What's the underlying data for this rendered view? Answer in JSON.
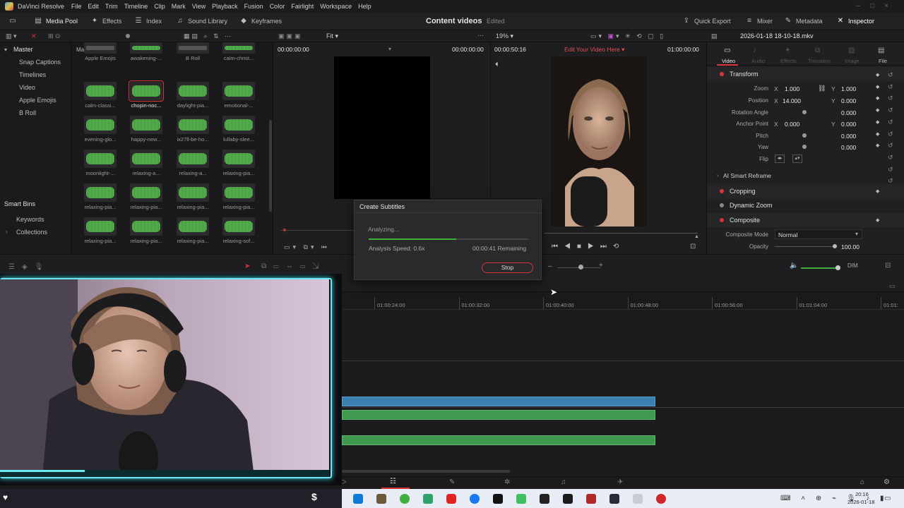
{
  "app": {
    "name": "DaVinci Resolve",
    "menus": [
      "File",
      "Edit",
      "Trim",
      "Timeline",
      "Clip",
      "Mark",
      "View",
      "Playback",
      "Fusion",
      "Color",
      "Fairlight",
      "Workspace",
      "Help"
    ]
  },
  "toolbar": {
    "media_pool": "Media Pool",
    "effects": "Effects",
    "index": "Index",
    "sound_library": "Sound Library",
    "keyframes": "Keyframes",
    "project_title": "Content videos",
    "project_status": "Edited",
    "quick_export": "Quick Export",
    "mixer": "Mixer",
    "metadata": "Metadata",
    "inspector": "Inspector"
  },
  "strip2": {
    "fit": "Fit",
    "zoom": "19%",
    "filename": "2026-01-18 18-10-18.mkv"
  },
  "bins": {
    "master": "Master",
    "items": [
      "Snap Captions",
      "Timelines",
      "Video",
      "Apple Emojis",
      "B Roll"
    ],
    "smart_bins": "Smart Bins",
    "smart_items": [
      "Keywords",
      "Collections"
    ]
  },
  "media": {
    "header": "Master",
    "clips": [
      "Apple Emojis",
      "awakening-...",
      "B Roll",
      "calm-christ...",
      "calm-classi...",
      "chopin-noc...",
      "daylight-pia...",
      "emotional-...",
      "evening-glo...",
      "happy-new...",
      "ix27ll-be-ho...",
      "lullaby-slee...",
      "moonlight-...",
      "relaxing-a...",
      "relaxing-a...",
      "relaxing-pia...",
      "relaxing-pia...",
      "relaxing-pia...",
      "relaxing-pia...",
      "relaxing-pia...",
      "relaxing-pia...",
      "relaxing-pia...",
      "relaxing-pia...",
      "relaxing-sof..."
    ]
  },
  "viewer": {
    "src_tc_left": "00:00:00:00",
    "src_tc_right": "00:00:00:00",
    "tl_tc_left": "00:00:50:16",
    "tl_title": "Edit Your Video Here",
    "tl_tc_right": "01:00:00:00"
  },
  "inspector": {
    "tabs": [
      "Video",
      "Audio",
      "Effects",
      "Transition",
      "Image",
      "File"
    ],
    "transform": "Transform",
    "zoom_label": "Zoom",
    "zoom_x": "1.000",
    "zoom_y": "1.000",
    "position_label": "Position",
    "position_x": "14.000",
    "position_y": "0.000",
    "rotation_label": "Rotation Angle",
    "rotation": "0.000",
    "anchor_label": "Anchor Point",
    "anchor_x": "0.000",
    "anchor_y": "0.000",
    "pitch_label": "Pitch",
    "pitch": "0.000",
    "yaw_label": "Yaw",
    "yaw": "0.000",
    "flip_label": "Flip",
    "ai_reframe": "AI Smart Reframe",
    "cropping": "Cropping",
    "dynamic_zoom": "Dynamic Zoom",
    "composite": "Composite",
    "composite_mode_label": "Composite Mode",
    "composite_mode": "Normal",
    "opacity_label": "Opacity",
    "opacity": "100.00",
    "x": "X",
    "y": "Y"
  },
  "dialog": {
    "title": "Create Subtitles",
    "status": "Analyzing...",
    "speed": "Analysis Speed: 0.6x",
    "remaining": "00:00:41 Remaining",
    "stop": "Stop",
    "progress": 0.55
  },
  "timeline": {
    "ticks": [
      "01:00:24:00",
      "01:00:32:00",
      "01:00:40:00",
      "01:00:48:00",
      "01:00:56:00",
      "01:01:04:00",
      "01:01:"
    ]
  },
  "audio": {
    "dim": "DIM"
  },
  "taskbar": {
    "time": "20:16",
    "date": "2026-01-18"
  },
  "colors": {
    "accent_red": "#d8343a",
    "clip_blue": "#3d7fb0",
    "clip_green": "#3f9a4f",
    "panel": "#1e1e20"
  }
}
